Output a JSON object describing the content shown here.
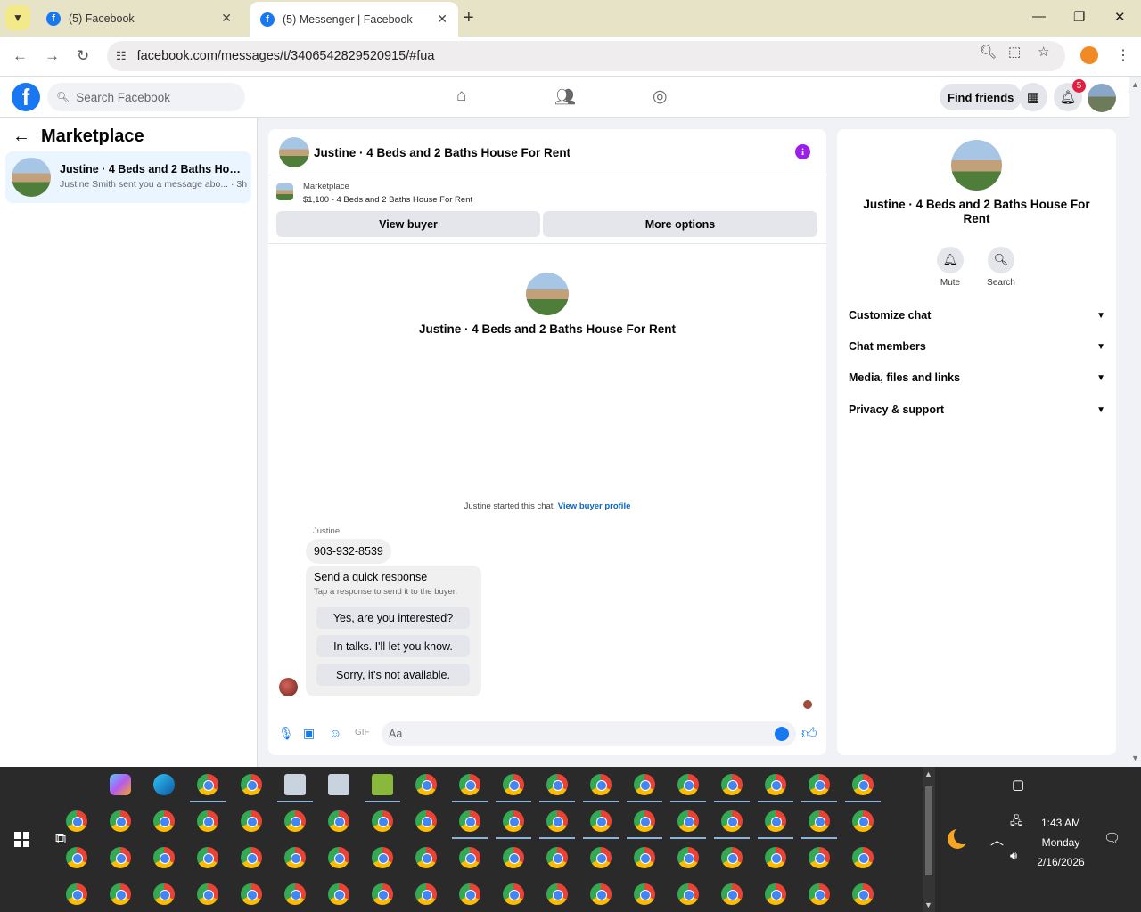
{
  "browser": {
    "tabs": [
      {
        "title": "(5) Facebook",
        "active": false
      },
      {
        "title": "(5) Messenger | Facebook",
        "active": true
      }
    ],
    "new_tab": "+",
    "url": "facebook.com/messages/t/3406542829520915/#fua",
    "controls": {
      "minimize": "—",
      "restore": "❐",
      "close": "✕"
    }
  },
  "fb_header": {
    "logo": "f",
    "search_placeholder": "Search Facebook",
    "find_friends": "Find friends",
    "notification_count": "5"
  },
  "left_panel": {
    "title": "Marketplace",
    "conversations": [
      {
        "title": "Justine · 4 Beds and 2 Baths House For Rent",
        "preview": "Justine Smith sent you a message abo... · 3h"
      }
    ]
  },
  "chat": {
    "title": "Justine · 4 Beds and 2 Baths House For Rent",
    "listing_category": "Marketplace",
    "listing_price": "$1,100 - 4 Beds and 2 Baths House For Rent",
    "view_buyer": "View buyer",
    "more_options": "More options",
    "profile_name": "Justine · 4 Beds and 2 Baths House For Rent",
    "started_text": "Justine started this chat.",
    "view_buyer_profile": "View buyer profile",
    "sender": "Justine",
    "message": "903-932-8539",
    "quick_response": {
      "title": "Send a quick response",
      "subtitle": "Tap a response to send it to the buyer.",
      "options": [
        "Yes, are you interested?",
        "In talks. I'll let you know.",
        "Sorry, it's not available."
      ]
    },
    "composer_placeholder": "Aa"
  },
  "right_panel": {
    "title": "Justine · 4 Beds and 2 Baths House For Rent",
    "actions": [
      {
        "label": "Mute",
        "icon": "bell-icon"
      },
      {
        "label": "Search",
        "icon": "search-icon"
      }
    ],
    "sections": [
      "Customize chat",
      "Chat members",
      "Media, files and links",
      "Privacy & support"
    ]
  },
  "taskbar": {
    "time": "1:43 AM",
    "day": "Monday",
    "date": "2/16/2026"
  }
}
